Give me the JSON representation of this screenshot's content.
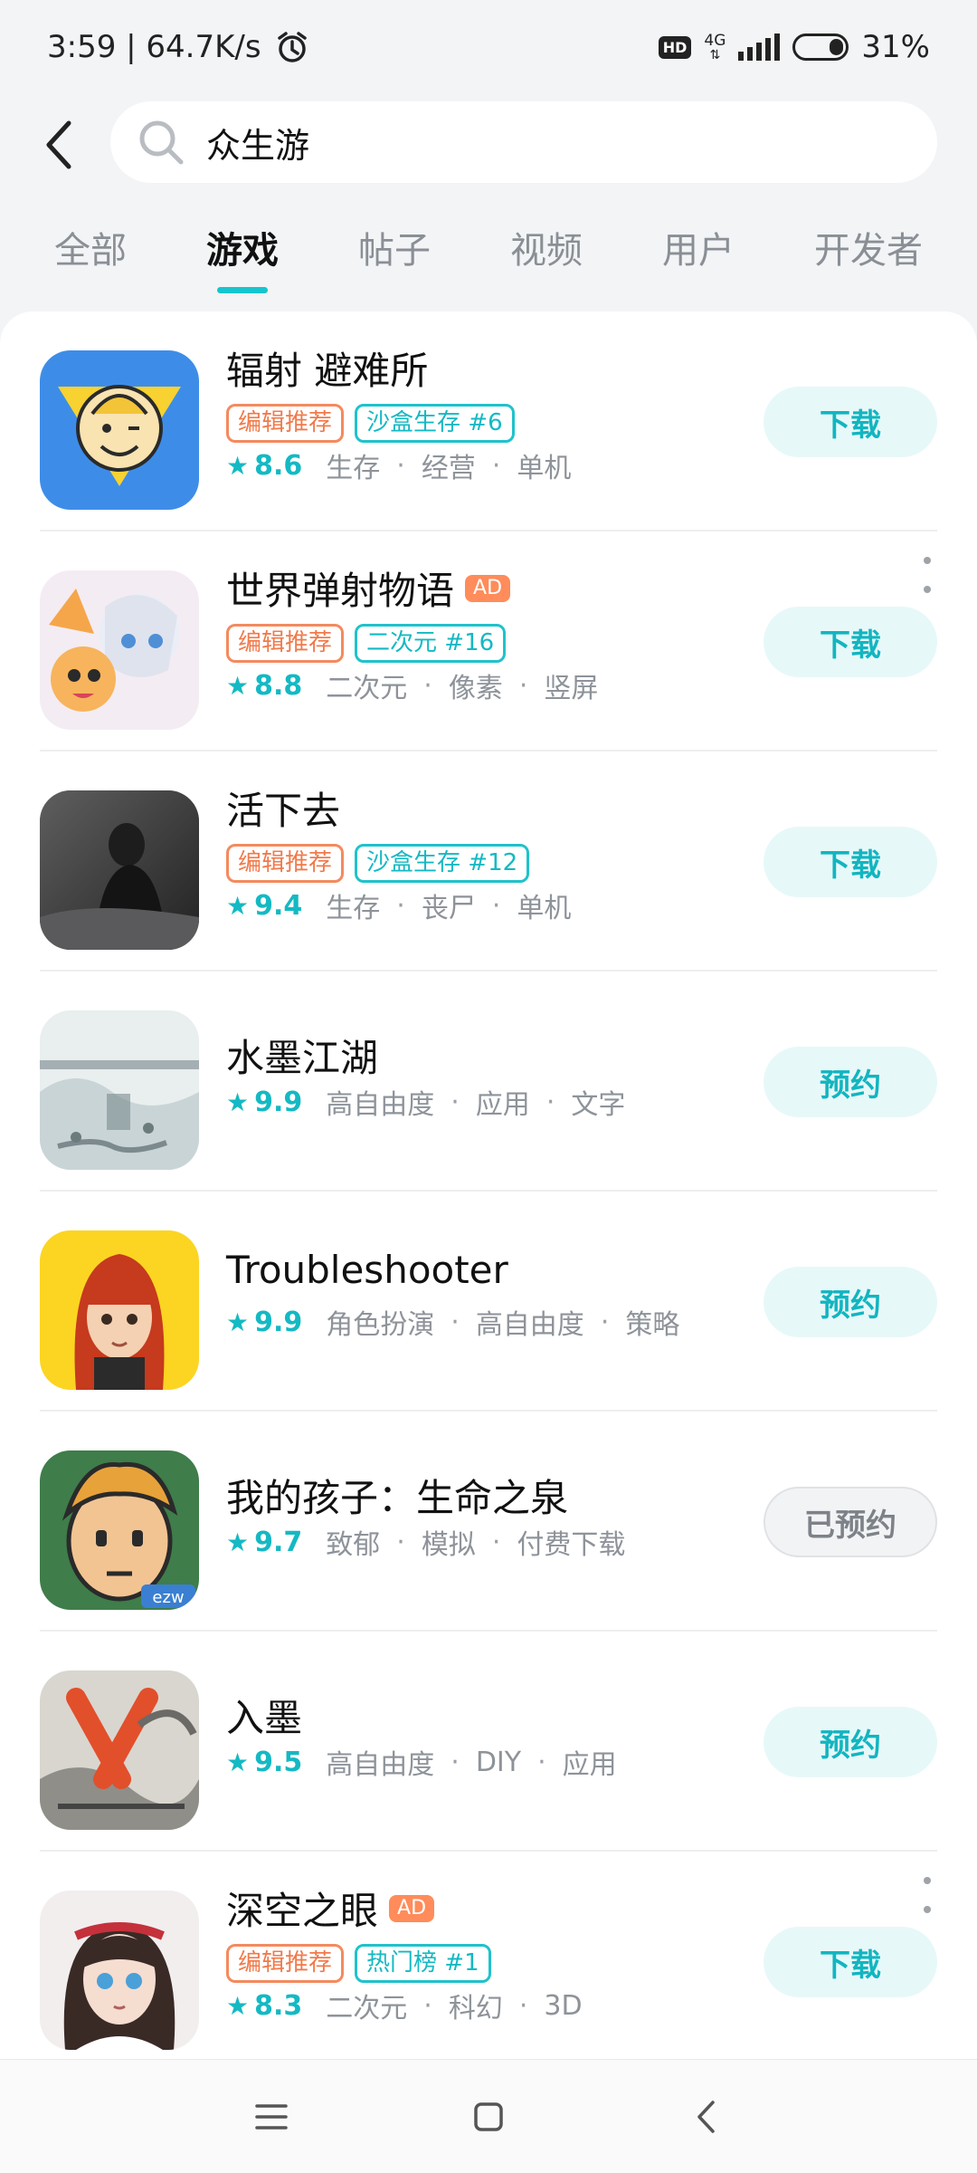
{
  "status_bar": {
    "time_speed": "3:59 | 64.7K/s",
    "network": "4G",
    "hd": "HD",
    "battery": "31%",
    "battery_level": 0.31
  },
  "search": {
    "query": "众生游"
  },
  "tabs": [
    {
      "label": "全部",
      "active": false
    },
    {
      "label": "游戏",
      "active": true
    },
    {
      "label": "帖子",
      "active": false
    },
    {
      "label": "视频",
      "active": false
    },
    {
      "label": "用户",
      "active": false
    },
    {
      "label": "开发者",
      "active": false
    }
  ],
  "apps": [
    {
      "name": "辐射 避难所",
      "ad": "",
      "tags": [
        {
          "text": "编辑推荐",
          "color": "orange"
        },
        {
          "text": "沙盒生存 #6",
          "color": "teal"
        }
      ],
      "rating": "8.6",
      "genres": [
        "生存",
        "经营",
        "单机"
      ],
      "action": "下载"
    },
    {
      "name": "世界弹射物语",
      "ad": "AD",
      "tags": [
        {
          "text": "编辑推荐",
          "color": "orange"
        },
        {
          "text": "二次元 #16",
          "color": "teal"
        }
      ],
      "rating": "8.8",
      "genres": [
        "二次元",
        "像素",
        "竖屏"
      ],
      "action": "下载"
    },
    {
      "name": "活下去",
      "ad": "",
      "tags": [
        {
          "text": "编辑推荐",
          "color": "orange"
        },
        {
          "text": "沙盒生存 #12",
          "color": "teal"
        }
      ],
      "rating": "9.4",
      "genres": [
        "生存",
        "丧尸",
        "单机"
      ],
      "action": "下载"
    },
    {
      "name": "水墨江湖",
      "ad": "",
      "tags": [],
      "rating": "9.9",
      "genres": [
        "高自由度",
        "应用",
        "文字"
      ],
      "action": "预约"
    },
    {
      "name": "Troubleshooter",
      "ad": "",
      "tags": [],
      "rating": "9.9",
      "genres": [
        "角色扮演",
        "高自由度",
        "策略"
      ],
      "action": "预约"
    },
    {
      "name": "我的孩子：生命之泉",
      "ad": "",
      "tags": [],
      "rating": "9.7",
      "genres": [
        "致郁",
        "模拟",
        "付费下载"
      ],
      "action": "已预约"
    },
    {
      "name": "入墨",
      "ad": "",
      "tags": [],
      "rating": "9.5",
      "genres": [
        "高自由度",
        "DIY",
        "应用"
      ],
      "action": "预约"
    },
    {
      "name": "深空之眼",
      "ad": "AD",
      "tags": [
        {
          "text": "编辑推荐",
          "color": "orange"
        },
        {
          "text": "热门榜 #1",
          "color": "teal"
        }
      ],
      "rating": "8.3",
      "genres": [
        "二次元",
        "科幻",
        "3D"
      ],
      "action": "下载"
    }
  ],
  "icons": {
    "back": "chevron-left-icon",
    "search": "search-icon",
    "menu": "menu-icon",
    "home": "home-icon",
    "nav_back": "back-icon",
    "star": "star-icon",
    "more": "more-vertical-icon"
  },
  "colors": {
    "accent": "#15c5ce",
    "tag_orange": "#f48a5e",
    "ad_badge": "#ff8c5a"
  }
}
